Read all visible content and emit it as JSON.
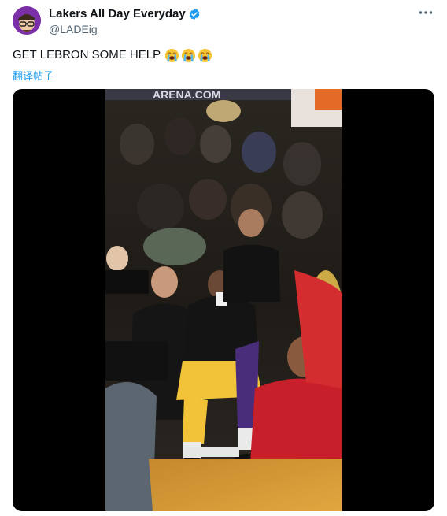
{
  "author": {
    "display_name": "Lakers All Day Everyday",
    "handle": "@LADEig",
    "verified": true,
    "avatar_icon": "avatar-glasses-cap",
    "avatar_color": "#7b2fa8"
  },
  "tweet": {
    "text": "GET LEBRON SOME HELP",
    "emojis": [
      "loudly-crying-face",
      "loudly-crying-face",
      "loudly-crying-face"
    ],
    "translate_label": "翻译帖子"
  },
  "media": {
    "type": "video",
    "description_icon": "video-thumbnail",
    "arena_sign": "ARENA.COM"
  },
  "colors": {
    "link": "#1d9bf0",
    "secondary_text": "#536471",
    "verified_badge": "#1d9bf0"
  },
  "icons": {
    "more": "more-horizontal-icon",
    "verified": "verified-badge-icon"
  }
}
